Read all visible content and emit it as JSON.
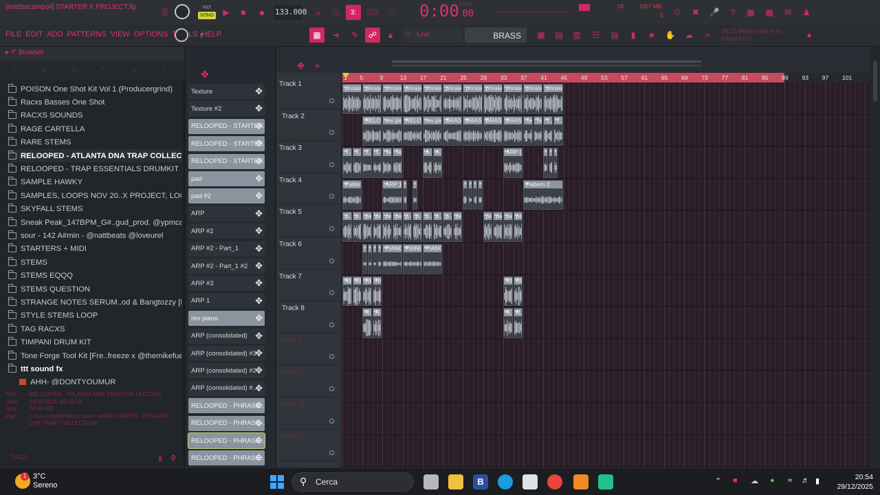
{
  "window": {
    "title": "[mattbacampoli] STARTER X PROJECT.flp"
  },
  "transport": {
    "pat_label": "PAT",
    "song_label": "SONG",
    "tempo": "133.000",
    "time": "0:00",
    "time_small": "00",
    "time_unit": "M:S:CS",
    "cpu": "18",
    "mem": "1007 MB",
    "mem2": "0"
  },
  "menu": [
    "FILE",
    "EDIT",
    "ADD",
    "PATTERNS",
    "VIEW",
    "OPTIONS",
    "TOOLS",
    "HELP"
  ],
  "toolbar": {
    "snap": "Line",
    "pattern_name": "BRASS",
    "news_time": "05:12",
    "news_text": "What's new in FL",
    "news_text2": "Cloud Pro?"
  },
  "browser": {
    "title": "Browser",
    "items": [
      {
        "label": "POISON One Shot Kit Vol 1 (Producergrind)"
      },
      {
        "label": "Racxs Basses One Shot"
      },
      {
        "label": "RACXS SOUNDS"
      },
      {
        "label": "RAGE CARTELLA"
      },
      {
        "label": "RARE STEMS"
      },
      {
        "label": "RELOOPED - ATLANTA DNA TRAP COLLECTION",
        "bold": true
      },
      {
        "label": "RELOOPED - TRAP ESSENTIALS DRUMKIT"
      },
      {
        "label": "SAMPLE HAWKY"
      },
      {
        "label": "SAMPLES, LOOPS NOV 20..X PROJECT, LOOP PACK"
      },
      {
        "label": "SKYFALL STEMS"
      },
      {
        "label": "Sneak Peak_147BPM_G#..gud_prod. @ypmcarter"
      },
      {
        "label": "sour - 142 A#min - @nattbeats @loveurel"
      },
      {
        "label": "STARTERS + MIDI"
      },
      {
        "label": "STEMS"
      },
      {
        "label": "STEMS EQQQ"
      },
      {
        "label": "STEMS QUESTION"
      },
      {
        "label": "STRANGE NOTES SERUM..od & Bangtozzy [FREE]"
      },
      {
        "label": "STYLE STEMS LOOP"
      },
      {
        "label": "TAG RACXS"
      },
      {
        "label": "TIMPANI DRUM KIT"
      },
      {
        "label": "Tone Forge Tool Kit [Fre..freeze x @themikefuego]"
      },
      {
        "label": "ttt sound fx",
        "bold": true
      },
      {
        "label": "AHH- @DONTYOUMUR",
        "audio": true
      }
    ],
    "info": {
      "title_k": "Title",
      "title_v": "RELOOPED - ATLANTA DNA TRAP COLLECTION",
      "date_k": "Date",
      "date_v": "04/11/2025 16:35:28",
      "size_k": "Size",
      "size_v": "24.00 KB",
      "path_k": "Path",
      "path_v": "C:\\Users\\gotti\\Music\\drum kit\\RELOOPED - ATLANTA DNA TRAP COLLECTION"
    },
    "tags_label": "TAGS"
  },
  "channels": [
    {
      "label": "Texture",
      "style": "dark"
    },
    {
      "label": "Texture #2",
      "style": "dark"
    },
    {
      "label": "RELOOPED - STARTER...",
      "style": "lite"
    },
    {
      "label": "RELOOPED - STARTER...",
      "style": "lite"
    },
    {
      "label": "RELOOPED - STARTER...",
      "style": "lite"
    },
    {
      "label": "pad",
      "style": "lite"
    },
    {
      "label": "pad #2",
      "style": "lite"
    },
    {
      "label": "ARP",
      "style": "dark"
    },
    {
      "label": "ARP #2",
      "style": "dark"
    },
    {
      "label": "ARP #2 - Part_1",
      "style": "dark"
    },
    {
      "label": "ARP #2 - Part_1 #2",
      "style": "dark"
    },
    {
      "label": "ARP #3",
      "style": "dark"
    },
    {
      "label": "ARP 1",
      "style": "dark"
    },
    {
      "label": "rev piano",
      "style": "lite"
    },
    {
      "label": "ARP (consolidated)",
      "style": "dark"
    },
    {
      "label": "ARP (consolidated) #3",
      "style": "dark"
    },
    {
      "label": "ARP (consolidated) #2",
      "style": "dark"
    },
    {
      "label": "ARP (consolidated) #...",
      "style": "dark"
    },
    {
      "label": "RELOOPED - PHRASE...",
      "style": "lite"
    },
    {
      "label": "RELOOPED - PHRASE...",
      "style": "lite"
    },
    {
      "label": "RELOOPED - PHRASE...",
      "style": "lite",
      "outline": true
    },
    {
      "label": "RELOOPED - PHRASE...",
      "style": "lite"
    }
  ],
  "playlist": {
    "tracks": [
      "Track 1",
      "Track 2",
      "Track 3",
      "Track 4",
      "Track 5",
      "Track 6",
      "Track 7",
      "Track 8",
      "Track 9",
      "Track 10",
      "Track 11",
      "Track 12"
    ],
    "ruler": [
      "1",
      "5",
      "9",
      "13",
      "17",
      "21",
      "25",
      "29",
      "33",
      "37",
      "41",
      "45",
      "49",
      "53",
      "57",
      "61",
      "65",
      "69",
      "73",
      "77",
      "81",
      "85",
      "89",
      "93",
      "97",
      "101"
    ],
    "clips": [
      {
        "row": 0,
        "start": 1,
        "len": 4,
        "label": "phrase"
      },
      {
        "row": 0,
        "start": 5,
        "len": 4,
        "label": "phrase"
      },
      {
        "row": 0,
        "start": 9,
        "len": 4,
        "label": "phrase"
      },
      {
        "row": 0,
        "start": 13,
        "len": 4,
        "label": "phrase"
      },
      {
        "row": 0,
        "start": 17,
        "len": 4,
        "label": "phrase"
      },
      {
        "row": 0,
        "start": 21,
        "len": 4,
        "label": "phrase #2"
      },
      {
        "row": 0,
        "start": 25,
        "len": 4,
        "label": "phrase"
      },
      {
        "row": 0,
        "start": 29,
        "len": 4,
        "label": "phrase"
      },
      {
        "row": 0,
        "start": 33,
        "len": 4,
        "label": "phrase"
      },
      {
        "row": 0,
        "start": 37,
        "len": 4,
        "label": "phrase"
      },
      {
        "row": 0,
        "start": 41,
        "len": 4,
        "label": "phrase"
      },
      {
        "row": 1,
        "start": 5,
        "len": 4,
        "label": "RELOO...rt_1"
      },
      {
        "row": 1,
        "start": 9,
        "len": 4,
        "label": "rev piano"
      },
      {
        "row": 1,
        "start": 13,
        "len": 4,
        "label": "RELOO...rt_1"
      },
      {
        "row": 1,
        "start": 17,
        "len": 4,
        "label": "rev piano"
      },
      {
        "row": 1,
        "start": 21,
        "len": 4,
        "label": "BRASS"
      },
      {
        "row": 1,
        "start": 25,
        "len": 4,
        "label": "BRASS"
      },
      {
        "row": 1,
        "start": 29,
        "len": 4,
        "label": "BRASS #2"
      },
      {
        "row": 1,
        "start": 33,
        "len": 4,
        "label": "BRASS #2"
      },
      {
        "row": 1,
        "start": 37,
        "len": 2,
        "label": "Te..2"
      },
      {
        "row": 1,
        "start": 39,
        "len": 2,
        "label": "Te..."
      },
      {
        "row": 1,
        "start": 41,
        "len": 2,
        "label": "T..re"
      },
      {
        "row": 1,
        "start": 43,
        "len": 2,
        "label": "T...re"
      },
      {
        "row": 2,
        "start": 1,
        "len": 2,
        "label": "T...re"
      },
      {
        "row": 2,
        "start": 3,
        "len": 2,
        "label": "T...re"
      },
      {
        "row": 2,
        "start": 5,
        "len": 2,
        "label": "T...re"
      },
      {
        "row": 2,
        "start": 7,
        "len": 2,
        "label": "T...re"
      },
      {
        "row": 2,
        "start": 9,
        "len": 2,
        "label": "Te..."
      },
      {
        "row": 2,
        "start": 11,
        "len": 2,
        "label": "Te..."
      },
      {
        "row": 2,
        "start": 17,
        "len": 2,
        "label": "A...2"
      },
      {
        "row": 2,
        "start": 19,
        "len": 2,
        "label": "A...2"
      },
      {
        "row": 2,
        "start": 33,
        "len": 4,
        "label": "ARP (c...ted)"
      },
      {
        "row": 2,
        "start": 41,
        "len": 1,
        "label": ""
      },
      {
        "row": 2,
        "start": 42,
        "len": 1,
        "label": ""
      },
      {
        "row": 2,
        "start": 43,
        "len": 1,
        "label": ""
      },
      {
        "row": 3,
        "start": 1,
        "len": 4,
        "label": "Pattern 1"
      },
      {
        "row": 3,
        "start": 9,
        "len": 4,
        "label": "ARP 1"
      },
      {
        "row": 3,
        "start": 13,
        "len": 1,
        "label": ""
      },
      {
        "row": 3,
        "start": 15,
        "len": 1,
        "label": ""
      },
      {
        "row": 3,
        "start": 25,
        "len": 1,
        "label": ""
      },
      {
        "row": 3,
        "start": 26,
        "len": 1,
        "label": ""
      },
      {
        "row": 3,
        "start": 27,
        "len": 1,
        "label": ""
      },
      {
        "row": 3,
        "start": 28,
        "len": 1,
        "label": ""
      },
      {
        "row": 3,
        "start": 37,
        "len": 8,
        "label": "Pattern 2"
      },
      {
        "row": 4,
        "start": 1,
        "len": 2,
        "label": "p...2"
      },
      {
        "row": 4,
        "start": 3,
        "len": 2,
        "label": "p...2"
      },
      {
        "row": 4,
        "start": 5,
        "len": 2,
        "label": "pad"
      },
      {
        "row": 4,
        "start": 7,
        "len": 2,
        "label": "pad"
      },
      {
        "row": 4,
        "start": 9,
        "len": 2,
        "label": "pad"
      },
      {
        "row": 4,
        "start": 11,
        "len": 2,
        "label": "pad"
      },
      {
        "row": 4,
        "start": 13,
        "len": 2,
        "label": "p...2"
      },
      {
        "row": 4,
        "start": 15,
        "len": 2,
        "label": "p...2"
      },
      {
        "row": 4,
        "start": 17,
        "len": 2,
        "label": "p...2"
      },
      {
        "row": 4,
        "start": 19,
        "len": 2,
        "label": "p...2"
      },
      {
        "row": 4,
        "start": 21,
        "len": 2,
        "label": "p...2"
      },
      {
        "row": 4,
        "start": 23,
        "len": 2,
        "label": "pad"
      },
      {
        "row": 4,
        "start": 29,
        "len": 2,
        "label": "pad"
      },
      {
        "row": 4,
        "start": 31,
        "len": 2,
        "label": "pad"
      },
      {
        "row": 4,
        "start": 33,
        "len": 2,
        "label": "pad"
      },
      {
        "row": 4,
        "start": 35,
        "len": 2,
        "label": "pad"
      },
      {
        "row": 5,
        "start": 5,
        "len": 1,
        "label": ""
      },
      {
        "row": 5,
        "start": 6,
        "len": 1,
        "label": ""
      },
      {
        "row": 5,
        "start": 7,
        "len": 1,
        "label": ""
      },
      {
        "row": 5,
        "start": 8,
        "len": 1,
        "label": ""
      },
      {
        "row": 5,
        "start": 9,
        "len": 4,
        "label": "PIANO"
      },
      {
        "row": 5,
        "start": 13,
        "len": 4,
        "label": "PIANO"
      },
      {
        "row": 5,
        "start": 17,
        "len": 4,
        "label": "PIANO"
      },
      {
        "row": 6,
        "start": 1,
        "len": 2,
        "label": "RE..."
      },
      {
        "row": 6,
        "start": 3,
        "len": 2,
        "label": "RE..."
      },
      {
        "row": 6,
        "start": 5,
        "len": 2,
        "label": "RE..."
      },
      {
        "row": 6,
        "start": 7,
        "len": 2,
        "label": "RE..."
      },
      {
        "row": 6,
        "start": 33,
        "len": 2,
        "label": "RE..."
      },
      {
        "row": 6,
        "start": 35,
        "len": 2,
        "label": "RE..."
      },
      {
        "row": 7,
        "start": 5,
        "len": 2,
        "label": "R...2"
      },
      {
        "row": 7,
        "start": 7,
        "len": 2,
        "label": "R...2"
      },
      {
        "row": 7,
        "start": 33,
        "len": 2,
        "label": "R...2"
      },
      {
        "row": 7,
        "start": 35,
        "len": 2,
        "label": "R...2"
      }
    ]
  },
  "taskbar": {
    "temperature": "3°C",
    "weather": "Sereno",
    "search_label": "Cerca",
    "time": "20:54",
    "date": "29/12/2025",
    "notif": "1"
  }
}
